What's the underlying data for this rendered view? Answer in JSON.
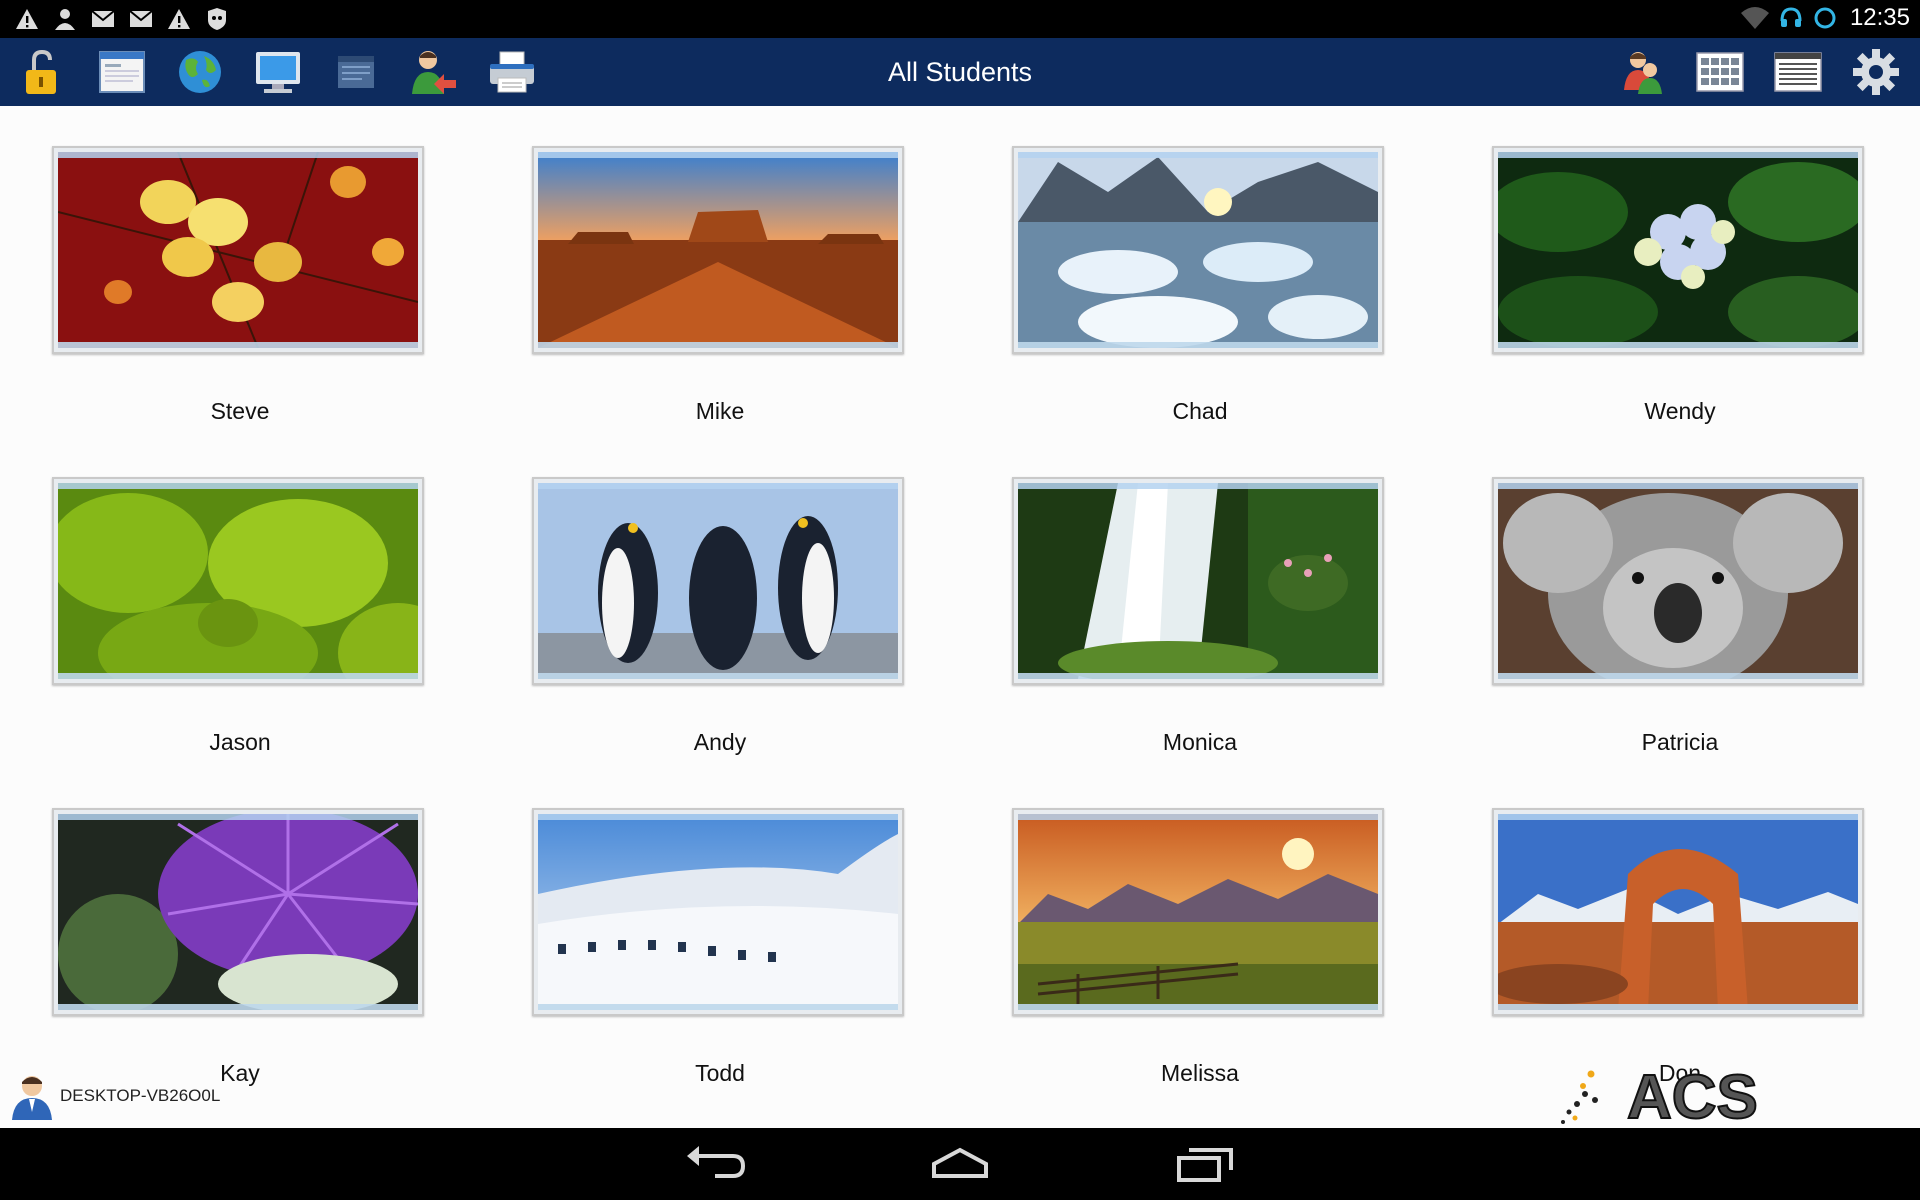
{
  "status_bar": {
    "time": "12:35",
    "left_icons": [
      "warning-icon",
      "person-icon",
      "mail-icon",
      "mail-icon",
      "warning-icon",
      "shield-icon"
    ],
    "right_icons": [
      "wifi-icon",
      "headset-icon",
      "sync-icon"
    ]
  },
  "toolbar": {
    "title": "All Students",
    "left_buttons": [
      "lock-icon",
      "window-icon",
      "globe-icon",
      "monitor-icon",
      "board-icon",
      "user-transfer-icon",
      "printer-icon"
    ],
    "right_buttons": [
      "users-icon",
      "grid-view-icon",
      "list-view-icon",
      "gear-icon"
    ],
    "background_color": "#0d2b5e"
  },
  "students": [
    {
      "name": "Steve",
      "wallpaper": "autumn-leaves"
    },
    {
      "name": "Mike",
      "wallpaper": "desert-mesa"
    },
    {
      "name": "Chad",
      "wallpaper": "ice-lake"
    },
    {
      "name": "Wendy",
      "wallpaper": "hydrangea"
    },
    {
      "name": "Jason",
      "wallpaper": "green-succulent"
    },
    {
      "name": "Andy",
      "wallpaper": "penguins"
    },
    {
      "name": "Monica",
      "wallpaper": "waterfall"
    },
    {
      "name": "Patricia",
      "wallpaper": "koala"
    },
    {
      "name": "Kay",
      "wallpaper": "purple-thistle"
    },
    {
      "name": "Todd",
      "wallpaper": "white-building"
    },
    {
      "name": "Melissa",
      "wallpaper": "sunset-field"
    },
    {
      "name": "Don",
      "wallpaper": "red-arch"
    }
  ],
  "footer": {
    "computer_name": "DESKTOP-VB26O0L",
    "logo_text": "ACS"
  },
  "nav_bar": {
    "buttons": [
      "back-icon",
      "home-icon",
      "recents-icon"
    ]
  }
}
